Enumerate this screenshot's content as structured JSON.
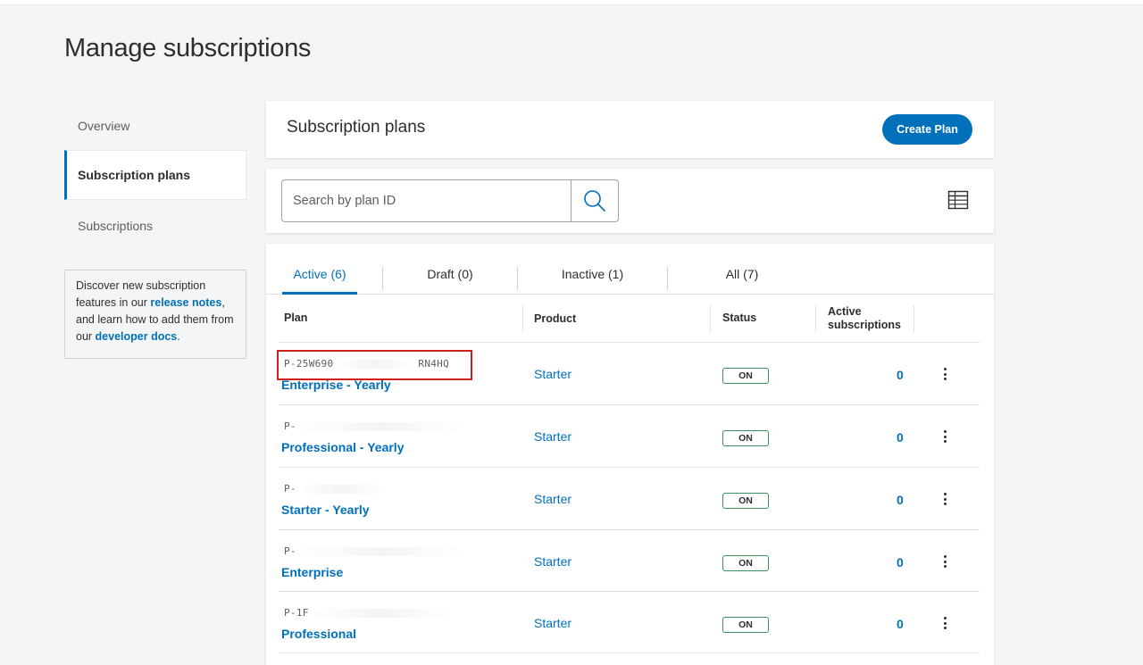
{
  "page": {
    "title": "Manage subscriptions"
  },
  "sidebar": {
    "items": [
      {
        "label": "Overview"
      },
      {
        "label": "Subscription plans"
      },
      {
        "label": "Subscriptions"
      }
    ],
    "info": {
      "text1": "Discover new subscription features in our ",
      "link1": "release notes",
      "text2": ", and learn how to add them from our ",
      "link2": "developer docs",
      "text3": "."
    }
  },
  "plans_header": {
    "title": "Subscription plans",
    "create_label": "Create Plan"
  },
  "search": {
    "placeholder": "Search by plan ID"
  },
  "tabs": [
    {
      "label": "Active (6)"
    },
    {
      "label": "Draft (0)"
    },
    {
      "label": "Inactive (1)"
    },
    {
      "label": "All (7)"
    }
  ],
  "columns": {
    "plan": "Plan",
    "product": "Product",
    "status": "Status",
    "active_line1": "Active",
    "active_line2": "subscriptions"
  },
  "rows": [
    {
      "id_prefix": "P-25W690",
      "id_suffix": "RN4HQ",
      "name": "Enterprise - Yearly",
      "product": "Starter",
      "status": "ON",
      "count": "0"
    },
    {
      "id_prefix": "P-",
      "id_suffix": "",
      "name": "Professional - Yearly",
      "product": "Starter",
      "status": "ON",
      "count": "0"
    },
    {
      "id_prefix": "P-",
      "id_suffix": "",
      "name": "Starter - Yearly",
      "product": "Starter",
      "status": "ON",
      "count": "0"
    },
    {
      "id_prefix": "P-",
      "id_suffix": "",
      "name": "Enterprise",
      "product": "Starter",
      "status": "ON",
      "count": "0"
    },
    {
      "id_prefix": "P-1F",
      "id_suffix": "",
      "name": "Professional",
      "product": "Starter",
      "status": "ON",
      "count": "0"
    }
  ],
  "colors": {
    "accent": "#0070ba",
    "status_border": "#3a8f5a",
    "highlight": "#d0201b"
  }
}
